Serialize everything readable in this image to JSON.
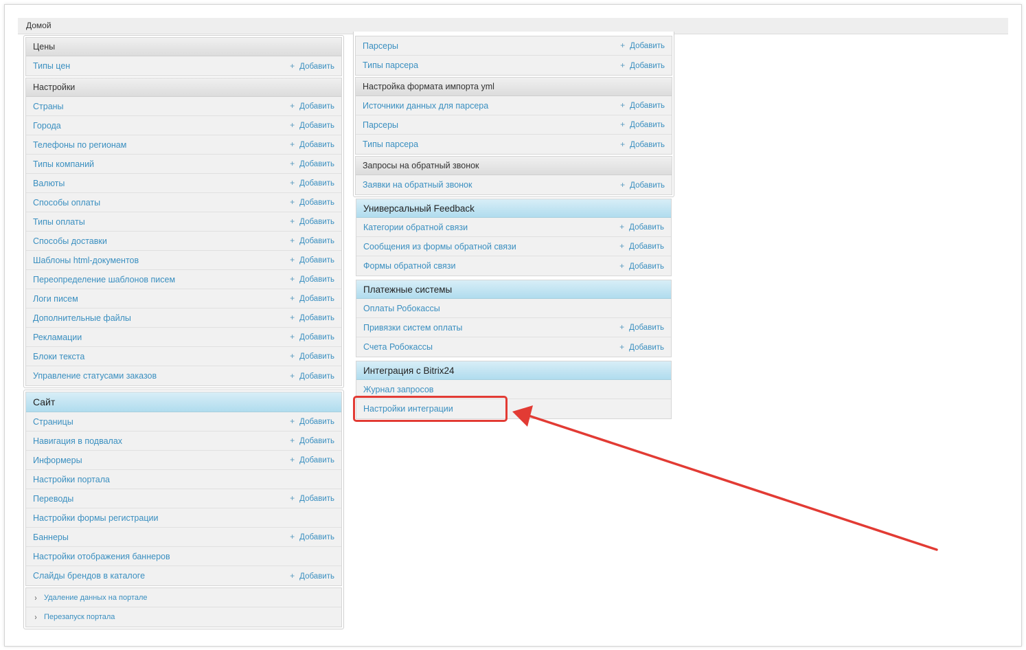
{
  "breadcrumb": "Домой",
  "add_label": "Добавить",
  "plus": "+",
  "left": {
    "prices": {
      "caption": "Цены",
      "items": [
        {
          "label": "Типы цен",
          "add": true
        }
      ]
    },
    "settings": {
      "caption": "Настройки",
      "items": [
        {
          "label": "Страны",
          "add": true
        },
        {
          "label": "Города",
          "add": true
        },
        {
          "label": "Телефоны по регионам",
          "add": true
        },
        {
          "label": "Типы компаний",
          "add": true
        },
        {
          "label": "Валюты",
          "add": true
        },
        {
          "label": "Способы оплаты",
          "add": true
        },
        {
          "label": "Типы оплаты",
          "add": true
        },
        {
          "label": "Способы доставки",
          "add": true
        },
        {
          "label": "Шаблоны html-документов",
          "add": true
        },
        {
          "label": "Переопределение шаблонов писем",
          "add": true
        },
        {
          "label": "Логи писем",
          "add": true
        },
        {
          "label": "Дополнительные файлы",
          "add": true
        },
        {
          "label": "Рекламации",
          "add": true
        },
        {
          "label": "Блоки текста",
          "add": true
        },
        {
          "label": "Управление статусами заказов",
          "add": true
        }
      ]
    },
    "site": {
      "caption": "Сайт",
      "items": [
        {
          "label": "Страницы",
          "add": true
        },
        {
          "label": "Навигация в подвалах",
          "add": true
        },
        {
          "label": "Информеры",
          "add": true
        },
        {
          "label": "Настройки портала",
          "add": false
        },
        {
          "label": "Переводы",
          "add": true
        },
        {
          "label": "Настройки формы регистрации",
          "add": false
        },
        {
          "label": "Баннеры",
          "add": true
        },
        {
          "label": "Настройки отображения баннеров",
          "add": false
        },
        {
          "label": "Слайды брендов в каталоге",
          "add": true
        }
      ]
    },
    "actions": [
      {
        "label": "Удаление данных на портале"
      },
      {
        "label": "Перезапуск портала"
      }
    ]
  },
  "right": {
    "parsers_top": {
      "items": [
        {
          "label": "Парсеры",
          "add": true
        },
        {
          "label": "Типы парсера",
          "add": true
        }
      ]
    },
    "yml": {
      "caption": "Настройка формата импорта yml",
      "items": [
        {
          "label": "Источники данных для парсера",
          "add": true
        },
        {
          "label": "Парсеры",
          "add": true
        },
        {
          "label": "Типы парсера",
          "add": true
        }
      ]
    },
    "callback": {
      "caption": "Запросы на обратный звонок",
      "items": [
        {
          "label": "Заявки на обратный звонок",
          "add": true
        }
      ]
    },
    "feedback": {
      "caption": "Универсальный Feedback",
      "items": [
        {
          "label": "Категории обратной связи",
          "add": true
        },
        {
          "label": "Сообщения из формы обратной связи",
          "add": true
        },
        {
          "label": "Формы обратной связи",
          "add": true
        }
      ]
    },
    "payments": {
      "caption": "Платежные системы",
      "items": [
        {
          "label": "Оплаты Робокассы",
          "add": false
        },
        {
          "label": "Привязки систем оплаты",
          "add": true
        },
        {
          "label": "Счета Робокассы",
          "add": true
        }
      ]
    },
    "bitrix": {
      "caption": "Интеграция с Bitrix24",
      "items": [
        {
          "label": "Журнал запросов",
          "add": false
        },
        {
          "label": "Настройки интеграции",
          "add": false
        }
      ]
    }
  },
  "colors": {
    "link": "#3a8fc0",
    "highlight": "#e23b34",
    "blue_caption": "#b0dcee"
  }
}
